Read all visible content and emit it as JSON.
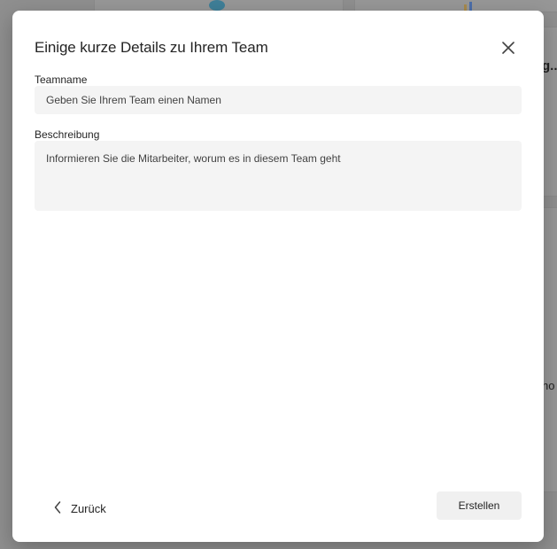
{
  "background": {
    "partial_text_right_top": "g...",
    "partial_text_right_mid": "ho"
  },
  "dialog": {
    "title": "Einige kurze Details zu Ihrem Team",
    "close_icon": "close-icon",
    "team_name_label": "Teamname",
    "team_name_placeholder": "Geben Sie Ihrem Team einen Namen",
    "description_label": "Beschreibung",
    "description_placeholder": "Informieren Sie die Mitarbeiter, worum es in diesem Team geht",
    "back_label": "Zurück",
    "back_icon": "chevron-left-icon",
    "create_label": "Erstellen"
  },
  "colors": {
    "overlay": "#8f8f8f",
    "dialog_bg": "#ffffff",
    "field_bg": "#f4f4f4",
    "button_bg": "#f0f0f0"
  }
}
